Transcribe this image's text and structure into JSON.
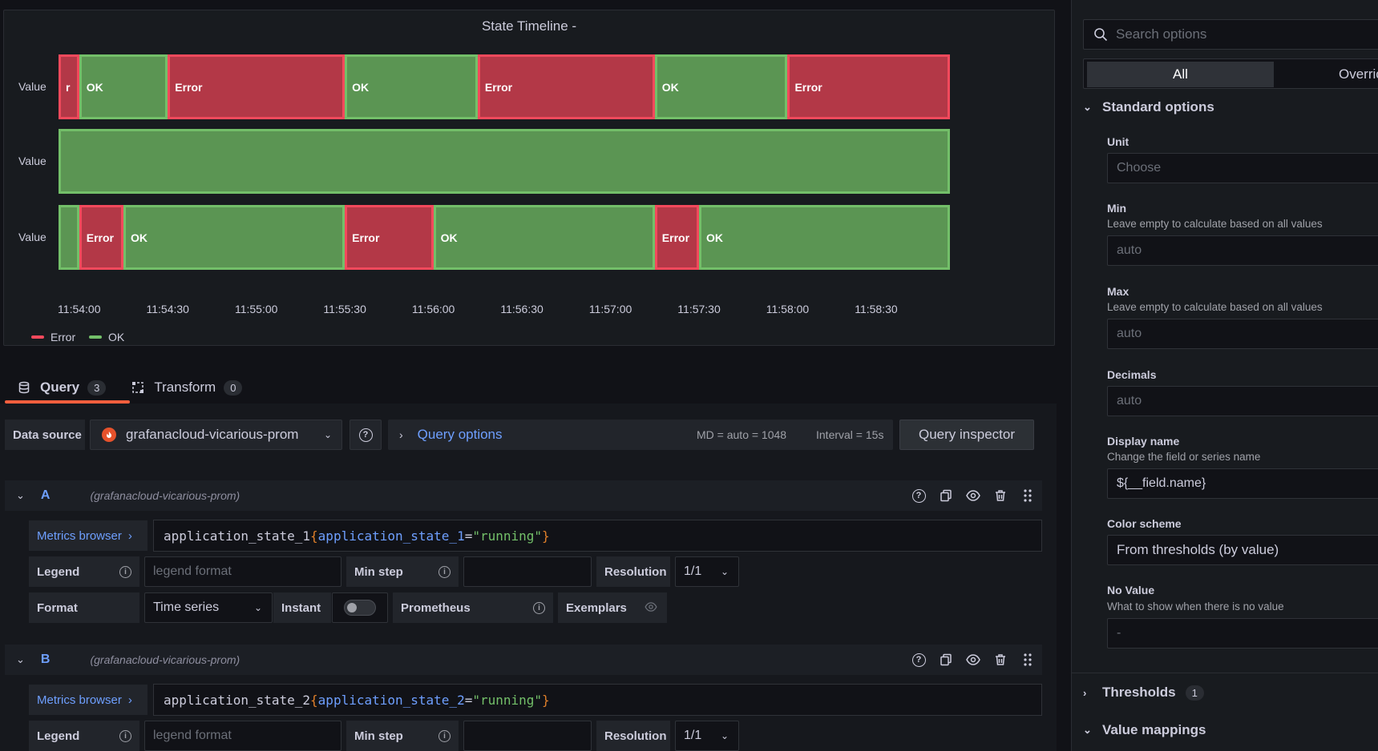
{
  "panel": {
    "title": "State Timeline -",
    "legend": [
      {
        "label": "Error",
        "color": "#f2495c"
      },
      {
        "label": "OK",
        "color": "#73bf69"
      }
    ]
  },
  "chart_data": {
    "type": "state-timeline",
    "title": "State Timeline -",
    "x_ticks": [
      "11:54:00",
      "11:54:30",
      "11:55:00",
      "11:55:30",
      "11:56:00",
      "11:56:30",
      "11:57:00",
      "11:57:30",
      "11:58:00",
      "11:58:30"
    ],
    "x_range": [
      "11:53:53",
      "11:58:55"
    ],
    "rows": [
      {
        "label": "Value",
        "segments": [
          {
            "state": "Error",
            "text": "r",
            "start": "11:53:53",
            "end": "11:54:00"
          },
          {
            "state": "OK",
            "text": "OK",
            "start": "11:54:00",
            "end": "11:54:30"
          },
          {
            "state": "Error",
            "text": "Error",
            "start": "11:54:30",
            "end": "11:55:30"
          },
          {
            "state": "OK",
            "text": "OK",
            "start": "11:55:30",
            "end": "11:56:15"
          },
          {
            "state": "Error",
            "text": "Error",
            "start": "11:56:15",
            "end": "11:57:15"
          },
          {
            "state": "OK",
            "text": "OK",
            "start": "11:57:15",
            "end": "11:58:00"
          },
          {
            "state": "Error",
            "text": "Error",
            "start": "11:58:00",
            "end": "11:58:55"
          }
        ]
      },
      {
        "label": "Value",
        "segments": [
          {
            "state": "OK",
            "text": "",
            "start": "11:53:53",
            "end": "11:58:55"
          }
        ]
      },
      {
        "label": "Value",
        "segments": [
          {
            "state": "OK",
            "text": "",
            "start": "11:53:53",
            "end": "11:54:00"
          },
          {
            "state": "Error",
            "text": "Error",
            "start": "11:54:00",
            "end": "11:54:15"
          },
          {
            "state": "OK",
            "text": "OK",
            "start": "11:54:15",
            "end": "11:55:30"
          },
          {
            "state": "Error",
            "text": "Error",
            "start": "11:55:30",
            "end": "11:56:00"
          },
          {
            "state": "OK",
            "text": "OK",
            "start": "11:56:00",
            "end": "11:57:15"
          },
          {
            "state": "Error",
            "text": "Error",
            "start": "11:57:15",
            "end": "11:57:30"
          },
          {
            "state": "OK",
            "text": "OK",
            "start": "11:57:30",
            "end": "11:58:55"
          }
        ]
      }
    ],
    "colors": {
      "OK": "#73bf69",
      "Error": "#f2495c"
    }
  },
  "tabs": [
    {
      "label": "Query",
      "count": "3",
      "icon": "database-icon"
    },
    {
      "label": "Transform",
      "count": "0",
      "icon": "transform-icon"
    }
  ],
  "toolbar": {
    "datasource_label": "Data source",
    "datasource_value": "grafanacloud-vicarious-prom",
    "query_options": "Query options",
    "md": "MD = auto = 1048",
    "interval": "Interval = 15s",
    "inspector": "Query inspector"
  },
  "queries": [
    {
      "ref": "A",
      "datasource": "(grafanacloud-vicarious-prom)",
      "metrics_browser": "Metrics browser",
      "expr_metric": "application_state_1",
      "expr_open": "{",
      "expr_key": "application_state_1",
      "expr_eq": "=",
      "expr_val": "\"running\"",
      "expr_close": "}",
      "legend_label": "Legend",
      "legend_placeholder": "legend format",
      "minstep_label": "Min step",
      "resolution_label": "Resolution",
      "resolution_value": "1/1",
      "format_label": "Format",
      "format_value": "Time series",
      "instant_label": "Instant",
      "prometheus_label": "Prometheus",
      "exemplars_label": "Exemplars"
    },
    {
      "ref": "B",
      "datasource": "(grafanacloud-vicarious-prom)",
      "metrics_browser": "Metrics browser",
      "expr_metric": "application_state_2",
      "expr_open": "{",
      "expr_key": "application_state_2",
      "expr_eq": "=",
      "expr_val": "\"running\"",
      "expr_close": "}",
      "legend_label": "Legend",
      "legend_placeholder": "legend format",
      "minstep_label": "Min step",
      "resolution_label": "Resolution",
      "resolution_value": "1/1"
    }
  ],
  "options": {
    "search_placeholder": "Search options",
    "tab_all": "All",
    "tab_overrides": "Overric",
    "standard_options": "Standard options",
    "unit_label": "Unit",
    "unit_placeholder": "Choose",
    "min_label": "Min",
    "min_desc": "Leave empty to calculate based on all values",
    "min_placeholder": "auto",
    "max_label": "Max",
    "max_desc": "Leave empty to calculate based on all values",
    "max_placeholder": "auto",
    "decimals_label": "Decimals",
    "decimals_placeholder": "auto",
    "display_name_label": "Display name",
    "display_name_desc": "Change the field or series name",
    "display_name_value": "${__field.name}",
    "color_scheme_label": "Color scheme",
    "color_scheme_value": "From thresholds (by value)",
    "no_value_label": "No Value",
    "no_value_desc": "What to show when there is no value",
    "no_value_placeholder": "-",
    "thresholds_label": "Thresholds",
    "thresholds_count": "1",
    "value_mappings_label": "Value mappings"
  }
}
